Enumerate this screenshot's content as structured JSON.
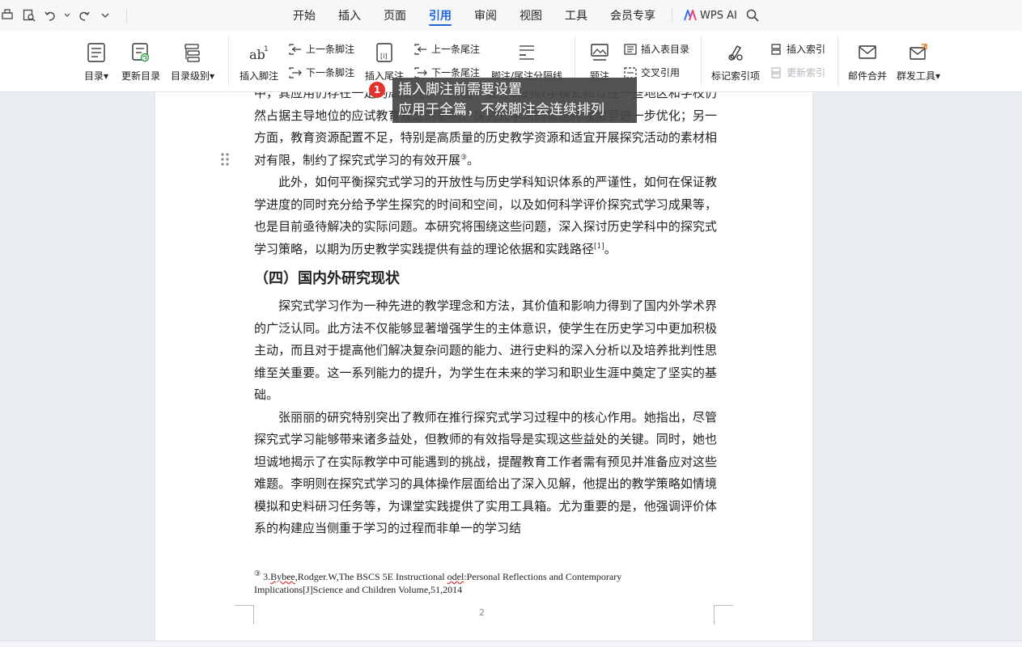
{
  "menubar": {
    "tabs": [
      {
        "label": "开始"
      },
      {
        "label": "插入"
      },
      {
        "label": "页面"
      },
      {
        "label": "引用",
        "active": true
      },
      {
        "label": "审阅"
      },
      {
        "label": "视图"
      },
      {
        "label": "工具"
      },
      {
        "label": "会员专享"
      }
    ],
    "wps_ai": "WPS AI",
    "accent": "#1d63dc"
  },
  "ribbon": {
    "toc": "目录",
    "update_toc": "更新目录",
    "toc_level": "目录级别",
    "insert_footnote": "插入脚注",
    "prev_footnote": "上一条脚注",
    "next_footnote": "下一条脚注",
    "insert_endnote": "插入尾注",
    "prev_endnote": "上一条尾注",
    "next_endnote": "下一条尾注",
    "footnote_separator": "脚注/尾注分隔线",
    "caption": "题注",
    "insert_table_of_figures": "插入表目录",
    "cross_reference": "交叉引用",
    "mark_index_entry": "标记索引项",
    "insert_index": "插入索引",
    "update_index": "更新索引",
    "mail_merge": "邮件合并",
    "mass_send": "群发工具"
  },
  "tooltip": {
    "badge": "1",
    "line1": "插入脚注前需要设置",
    "line2": "应用于全篇，不然脚注会连续排列"
  },
  "document": {
    "p0": "中，其应用仍存在一定的局限性。一方面，受传统的教学模式和以往一些地区和学校仍然占据主导地位的应试教育观念的影响，探究式学习的实施环境需要进一步优化；另一方面，教育资源配置不足，特别是高质量的历史教学资源和适宜开展探究活动的素材相对有限，制约了探究式学习的有效开展",
    "p0_sup": "③",
    "p0_end": "。",
    "p1": "此外，如何平衡探究式学习的开放性与历史学科知识体系的严谨性，如何在保证教学进度的同时充分给予学生探究的时间和空间，以及如何科学评价探究式学习成果等，也是目前亟待解决的实际问题。本研究将围绕这些问题，深入探讨历史学科中的探究式学习策略，以期为历史教学实践提供有益的理论依据和实践路径",
    "p1_sup": "[1]",
    "p1_end": "。",
    "heading": "（四）国内外研究现状",
    "p2": "探究式学习作为一种先进的教学理念和方法，其价值和影响力得到了国内外学术界的广泛认同。此方法不仅能够显著增强学生的主体意识，使学生在历史学习中更加积极主动，而且对于提高他们解决复杂问题的能力、进行史料的深入分析以及培养批判性思维至关重要。这一系列能力的提升，为学生在未来的学习和职业生涯中奠定了坚实的基础。",
    "p3": "张丽丽的研究特别突出了教师在推行探究式学习过程中的核心作用。她指出，尽管探究式学习能够带来诸多益处，但教师的有效指导是实现这些益处的关键。同时，她也坦诚地揭示了在实际教学中可能遇到的挑战，提醒教育工作者需有预见并准备应对这些难题。李明则在探究式学习的具体操作层面给出了深入见解，他提出的教学策略如情境模拟和史料研习任务等，为课堂实践提供了实用工具箱。尤为重要的是，他强调评价体系的构建应当侧重于学习的过程而非单一的学习结",
    "footnote_mark": "③",
    "footnote_a": "3.",
    "footnote_b": "Bybee",
    "footnote_c": ",Rodger.W,The BSCS 5E Instructional ",
    "footnote_d": "odel",
    "footnote_e": ":Personal Reflections and Contemporary Implications[J]Science and Children Volume,51,2014",
    "page_number": "2"
  }
}
